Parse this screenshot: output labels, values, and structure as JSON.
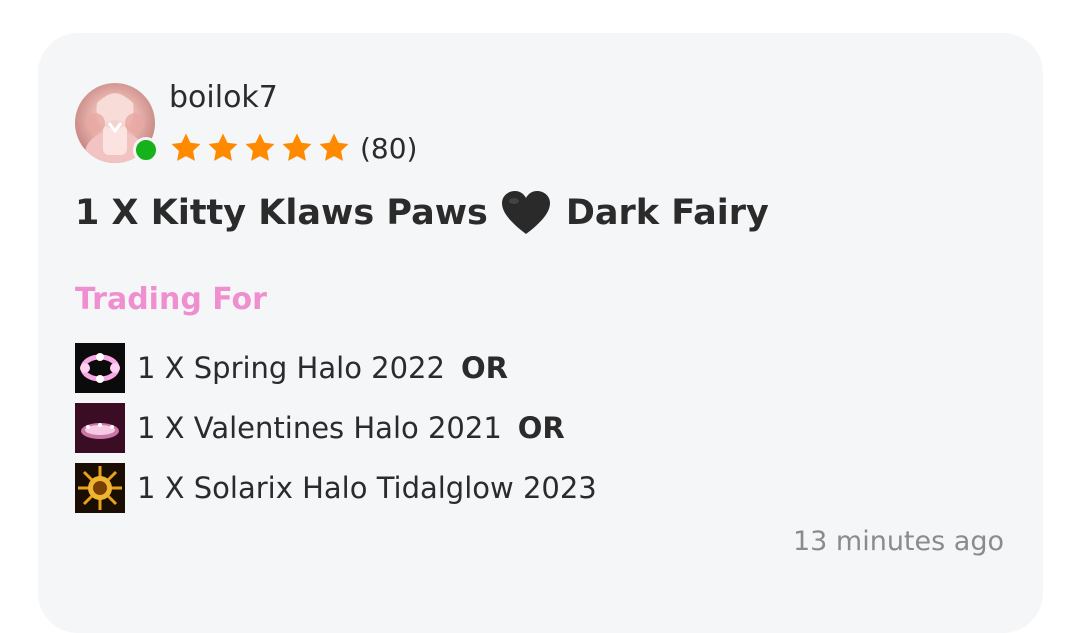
{
  "listing": {
    "seller": {
      "username": "boilok7",
      "online": true,
      "rating_stars": 5,
      "rating_count": "(80)"
    },
    "offer": {
      "quantity_prefix": "1 X Kitty Klaws Paws",
      "emoji": "black-heart-icon",
      "suffix": "Dark Fairy"
    },
    "trading_for_label": "Trading For",
    "wants": [
      {
        "label": "1 X Spring Halo 2022",
        "or": "OR",
        "icon": "spring-halo-icon"
      },
      {
        "label": "1 X Valentines Halo 2021",
        "or": "OR",
        "icon": "valentines-halo-icon"
      },
      {
        "label": "1 X Solarix Halo Tidalglow 2023",
        "or": "",
        "icon": "solarix-halo-icon"
      }
    ],
    "timestamp": "13 minutes ago"
  },
  "colors": {
    "card_bg": "#f5f6f8",
    "accent_pink": "#f08fd0",
    "star_orange": "#ff8a00",
    "online_green": "#16b11b",
    "muted_text": "#8b8b8b"
  }
}
